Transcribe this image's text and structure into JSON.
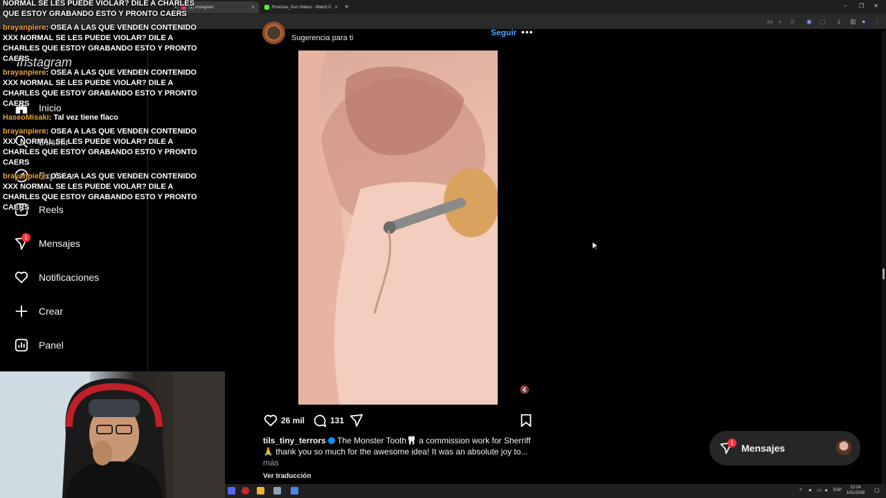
{
  "browser": {
    "tabs": [
      {
        "title": "",
        "active": false
      },
      {
        "title": "(1) Instagram",
        "active": true
      },
      {
        "title": "Ronchas_Kun Videos - Watch C",
        "active": false
      }
    ],
    "new_tab": "+"
  },
  "chat": [
    {
      "user": "",
      "text": "NORMAL SE LES PUEDE VIOLAR? DILE A CHARLES QUE ESTOY GRABANDO ESTO Y PRONTO CAERS"
    },
    {
      "user": "brayanpiere",
      "text": "OSEA A LAS QUE VENDEN CONTENIDO XXX NORMAL SE LES PUEDE VIOLAR? DILE A CHARLES QUE ESTOY GRABANDO ESTO Y PRONTO CAERS"
    },
    {
      "user": "brayanpiere",
      "text": "OSEA A LAS QUE VENDEN CONTENIDO XXX NORMAL SE LES PUEDE VIOLAR? DILE A CHARLES QUE ESTOY GRABANDO ESTO Y PRONTO CAERS"
    },
    {
      "user": "HaseoMisaki",
      "text": "Tal vez tiene flaco"
    },
    {
      "user": "brayanpiere",
      "text": "OSEA A LAS QUE VENDEN CONTENIDO XXX NORMAL SE LES PUEDE VIOLAR? DILE A CHARLES QUE ESTOY GRABANDO ESTO Y PRONTO CAERS"
    },
    {
      "user": "brayanpiere",
      "text": "OSEA A LAS QUE VENDEN CONTENIDO XXX NORMAL SE LES PUEDE VIOLAR? DILE A CHARLES QUE ESTOY GRABANDO ESTO Y PRONTO CAERS"
    }
  ],
  "sidebar": {
    "logo": "Instagram",
    "items": [
      {
        "label": "Inicio",
        "icon": "home-icon"
      },
      {
        "label": "Buscar",
        "icon": "search-icon"
      },
      {
        "label": "Explorar",
        "icon": "compass-icon"
      },
      {
        "label": "Reels",
        "icon": "reels-icon"
      },
      {
        "label": "Mensajes",
        "icon": "messenger-icon",
        "badge": "1"
      },
      {
        "label": "Notificaciones",
        "icon": "heart-icon"
      },
      {
        "label": "Crear",
        "icon": "plus-icon"
      },
      {
        "label": "Panel",
        "icon": "dashboard-icon"
      }
    ]
  },
  "post": {
    "suggestion": "Sugerencia para ti",
    "follow": "Seguir",
    "more": "•••",
    "likes": "26 mil",
    "comments": "131",
    "caption_user": "tils_tiny_terrors",
    "caption_text": "The Monster Tooth🦷 a commission work for Sherriff 🙏 thank you so much for the awesome idea! It was an absolute joy to...",
    "caption_more": "más",
    "translate": "Ver traducción"
  },
  "messages_pill": {
    "label": "Mensajes",
    "badge": "1"
  },
  "taskbar": {
    "lang": "ESP",
    "time": "22:24",
    "date": "1/01/2026"
  },
  "colors": {
    "accent": "#4aa3ff",
    "badge": "#ff3040",
    "chat_user": "#e8a13a"
  }
}
